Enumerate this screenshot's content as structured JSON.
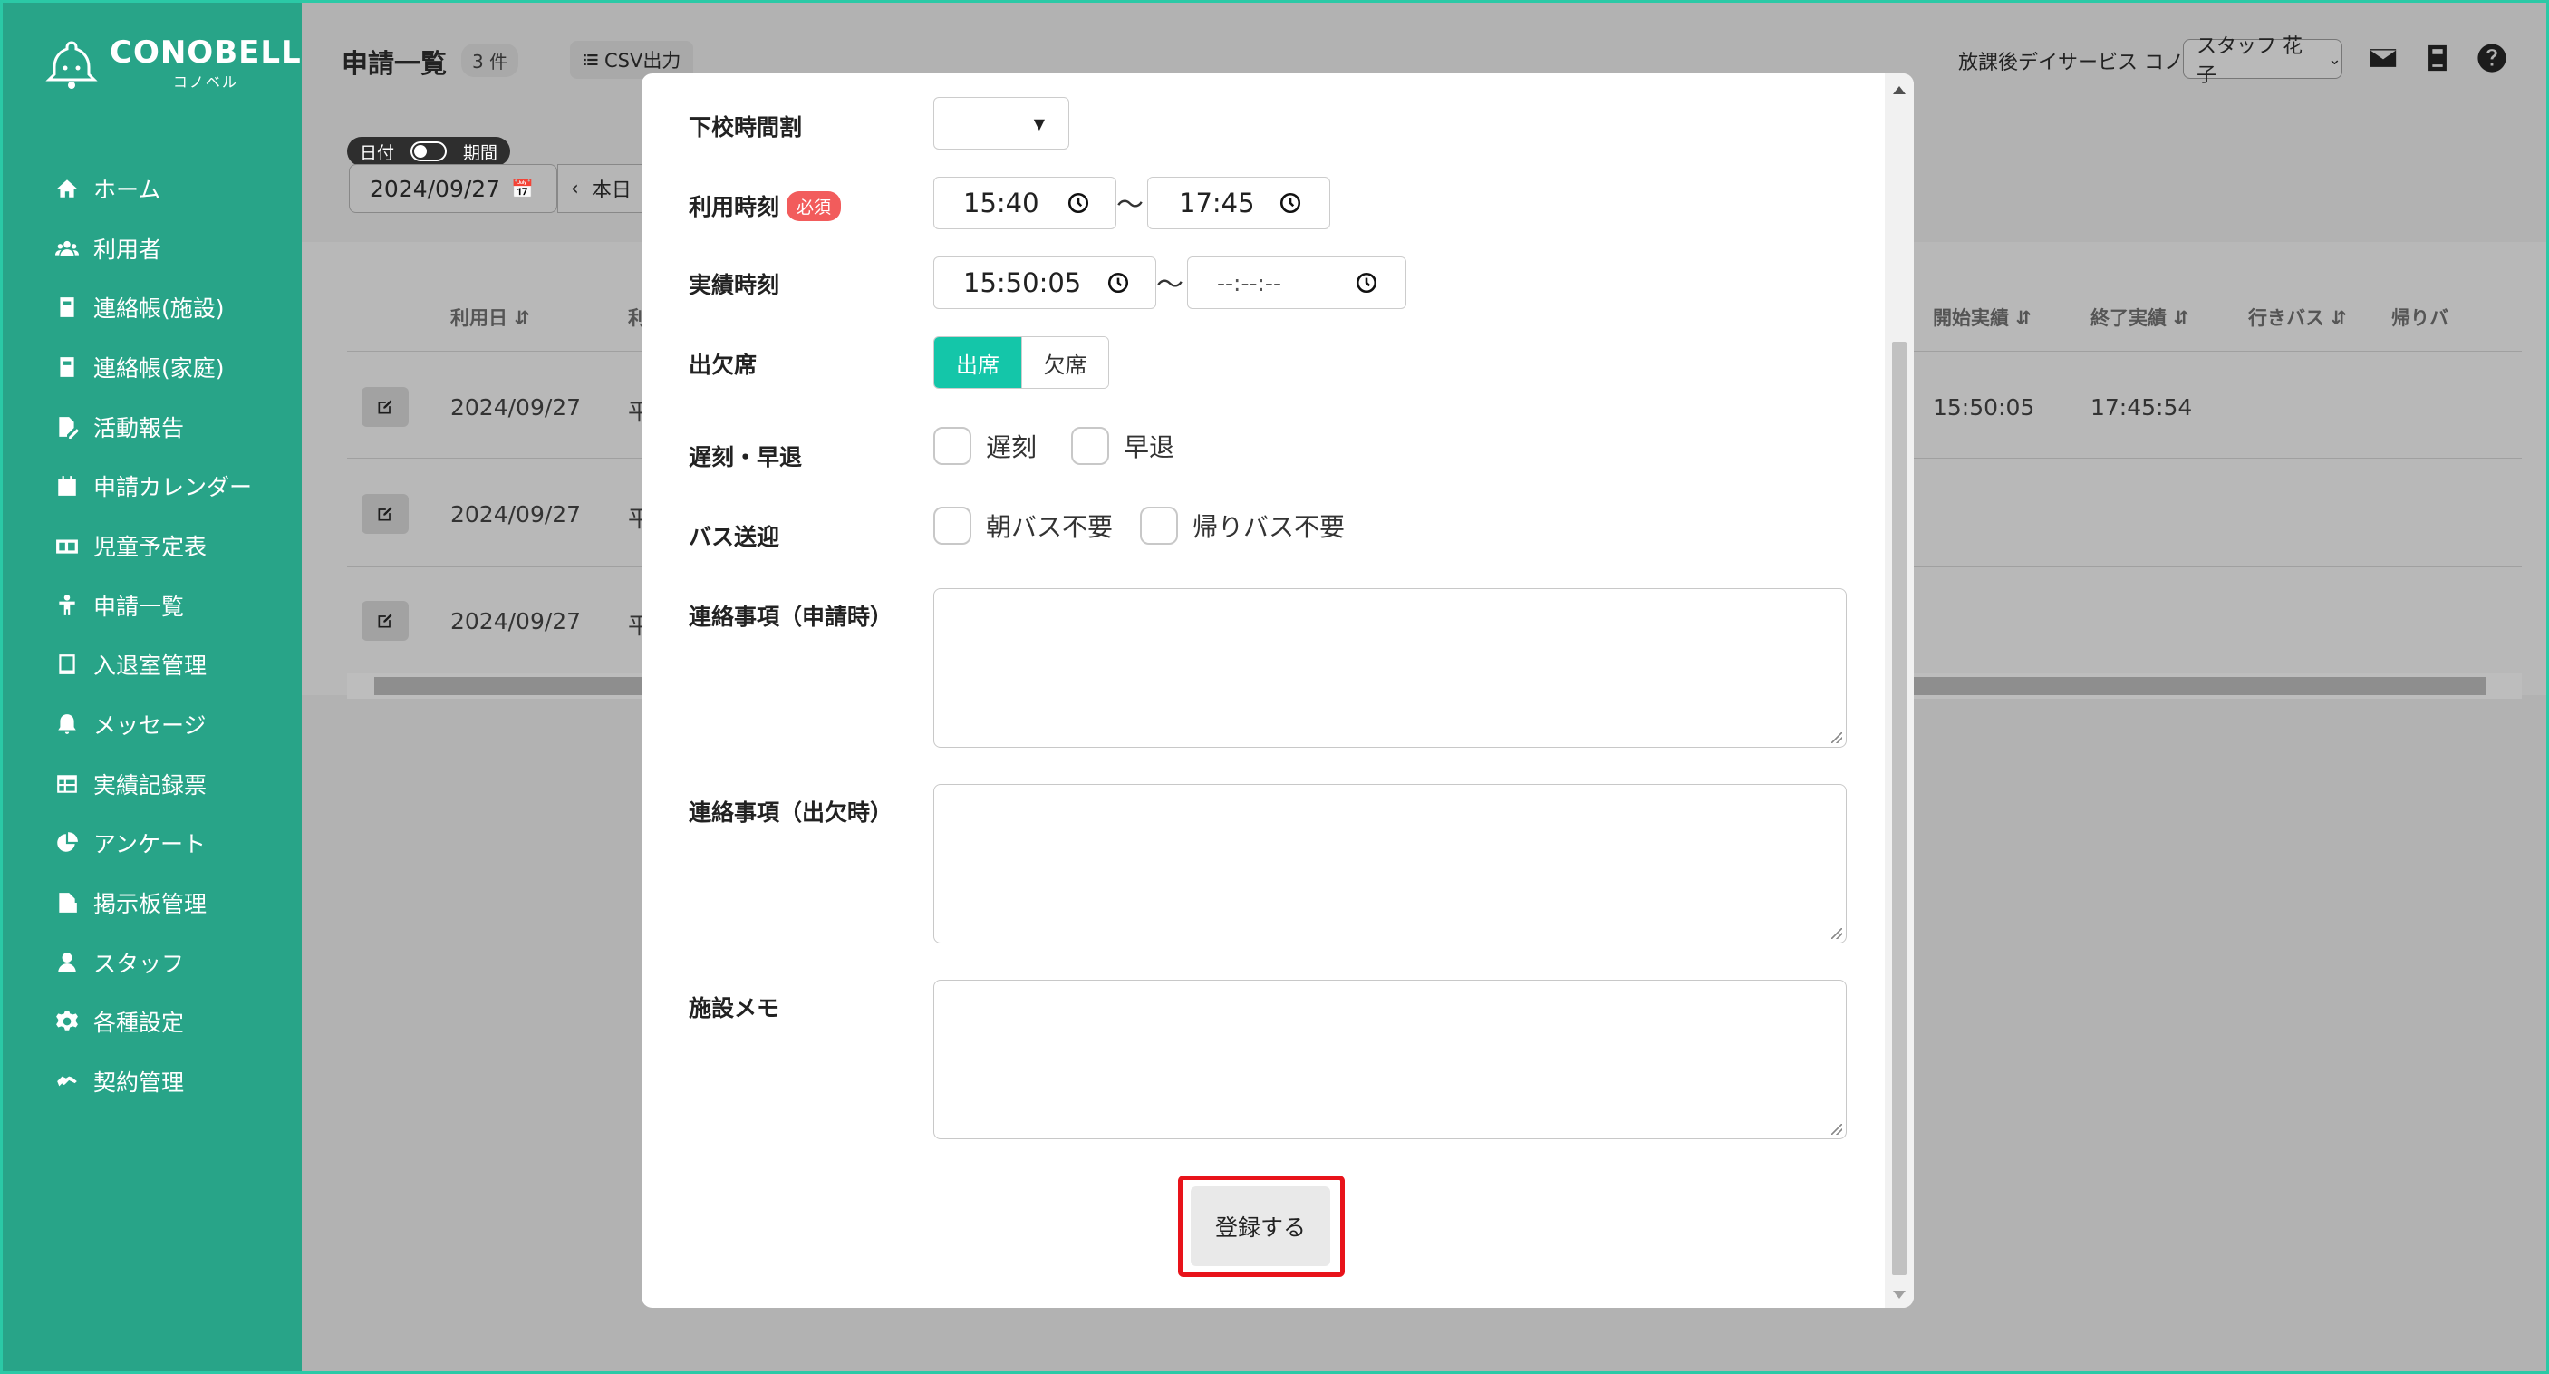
{
  "brand": {
    "name": "CONOBELL",
    "kana": "コノベル"
  },
  "sidebar": {
    "items": [
      {
        "label": "ホーム",
        "icon": "home-icon"
      },
      {
        "label": "利用者",
        "icon": "users-icon"
      },
      {
        "label": "連絡帳(施設)",
        "icon": "notebook-icon"
      },
      {
        "label": "連絡帳(家庭)",
        "icon": "notebook-icon"
      },
      {
        "label": "活動報告",
        "icon": "file-pen-icon"
      },
      {
        "label": "申請カレンダー",
        "icon": "calendar-icon"
      },
      {
        "label": "児童予定表",
        "icon": "schedule-icon"
      },
      {
        "label": "申請一覧",
        "icon": "child-icon"
      },
      {
        "label": "入退室管理",
        "icon": "tablet-icon"
      },
      {
        "label": "メッセージ",
        "icon": "bell-icon"
      },
      {
        "label": "実績記録票",
        "icon": "table-icon"
      },
      {
        "label": "アンケート",
        "icon": "pie-chart-icon"
      },
      {
        "label": "掲示板管理",
        "icon": "file-image-icon"
      },
      {
        "label": "スタッフ",
        "icon": "user-icon"
      },
      {
        "label": "各種設定",
        "icon": "gear-icon"
      },
      {
        "label": "契約管理",
        "icon": "handshake-icon"
      }
    ]
  },
  "header": {
    "title": "申請一覧",
    "count": "3 件",
    "csv_label": "CSV出力",
    "facility": "放課後デイサービス コノベル",
    "staff": "スタッフ 花子"
  },
  "filter": {
    "toggle_left": "日付",
    "toggle_right": "期間",
    "date": "2024/09/27",
    "today_label": "本日"
  },
  "table": {
    "headers": {
      "date": "利用日",
      "partial": "利",
      "start": "開始実績",
      "end": "終了実績",
      "bus_go": "行きバス",
      "bus_back": "帰りバ"
    },
    "rows": [
      {
        "date": "2024/09/27",
        "partial": "平",
        "start": "15:50:05",
        "end": "17:45:54"
      },
      {
        "date": "2024/09/27",
        "partial": "平",
        "start": "",
        "end": ""
      },
      {
        "date": "2024/09/27",
        "partial": "平",
        "start": "",
        "end": ""
      }
    ]
  },
  "modal": {
    "school_period_label": "下校時間割",
    "use_time_label": "利用時刻",
    "required_label": "必須",
    "use_time_start": "15:40",
    "use_time_end": "17:45",
    "actual_time_label": "実績時刻",
    "actual_time_start": "15:50:05",
    "actual_time_end": "--:--:--",
    "tilde": "〜",
    "attendance_label": "出欠席",
    "attend_on": "出席",
    "attend_off": "欠席",
    "late_early_label": "遅刻・早退",
    "late": "遅刻",
    "early": "早退",
    "bus_label": "バス送迎",
    "bus_morning": "朝バス不要",
    "bus_return": "帰りバス不要",
    "note_apply_label": "連絡事項（申請時）",
    "note_attend_label": "連絡事項（出欠時）",
    "facility_memo_label": "施設メモ",
    "submit": "登録する"
  },
  "colors": {
    "sidebar": "#28a488",
    "accent": "#14c6a9",
    "required": "#f25c5c",
    "highlight": "#e8131a"
  }
}
